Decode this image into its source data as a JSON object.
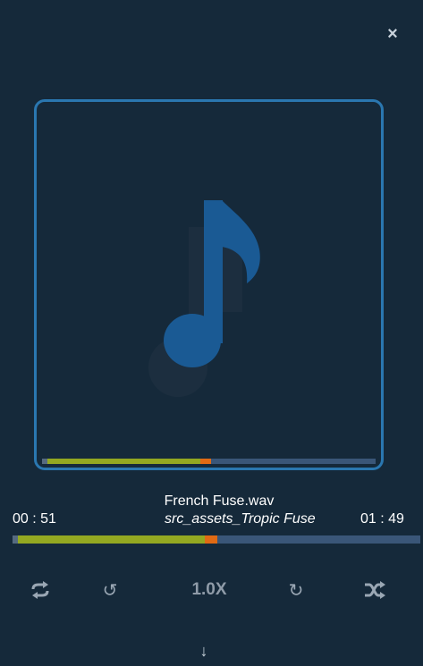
{
  "player": {
    "close_icon": "close-icon",
    "album_art_icon": "music-note-icon",
    "track_title": "French Fuse.wav",
    "source_name": "src_assets_Tropic Fuse",
    "time_elapsed": "00 : 51",
    "time_total": "01 : 49",
    "progress_fraction": 0.465,
    "controls": {
      "repeat_icon": "repeat-icon",
      "back_icon": "rewind-icon",
      "speed_label": "1.0X",
      "forward_icon": "fast-forward-icon",
      "shuffle_icon": "shuffle-icon"
    },
    "download_icon": "download-icon"
  },
  "colors": {
    "background": "#15293a",
    "frame_border": "#2a77b0",
    "note": "#1a5a94",
    "progress_played": "#93a821",
    "progress_buffer": "#e06a14",
    "progress_track": "#3a5678"
  }
}
